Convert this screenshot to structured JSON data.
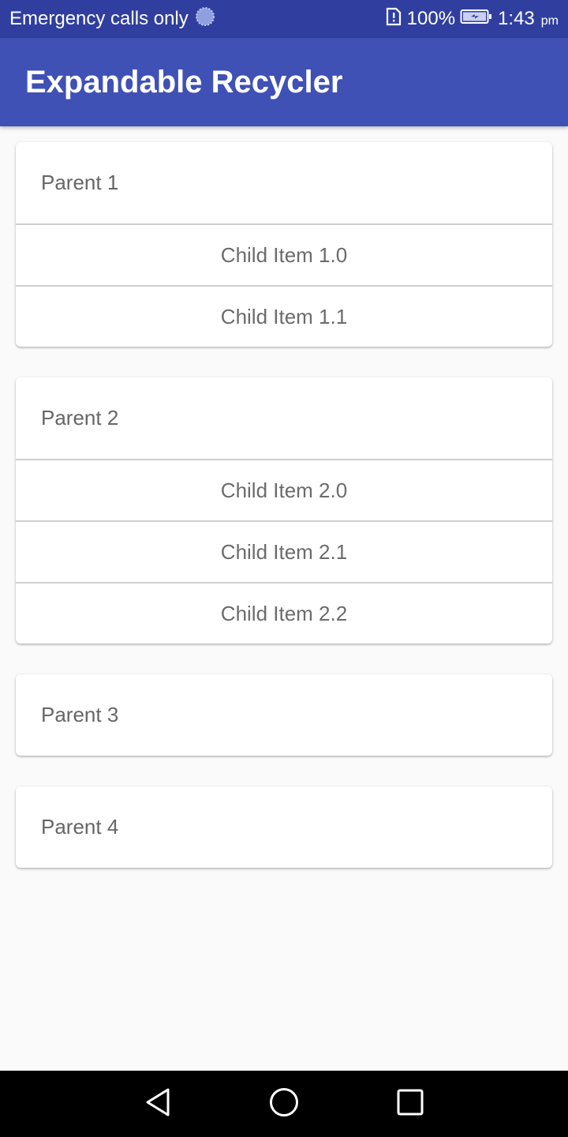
{
  "status_bar": {
    "carrier": "Emergency calls only",
    "battery": "100%",
    "time": "1:43",
    "ampm": "pm",
    "icons": [
      "sync-icon",
      "sim-alert-icon",
      "battery-charging-icon"
    ]
  },
  "app_bar": {
    "title": "Expandable Recycler"
  },
  "groups": [
    {
      "parent": "Parent 1",
      "children": [
        "Child Item 1.0",
        "Child Item 1.1"
      ]
    },
    {
      "parent": "Parent 2",
      "children": [
        "Child Item 2.0",
        "Child Item 2.1",
        "Child Item 2.2"
      ]
    },
    {
      "parent": "Parent 3",
      "children": []
    },
    {
      "parent": "Parent 4",
      "children": []
    }
  ],
  "nav_bar": {
    "icons": [
      "back-icon",
      "home-icon",
      "recents-icon"
    ]
  },
  "colors": {
    "status_bar": "#303f9f",
    "app_bar": "#3f51b5",
    "background": "#fafafa",
    "text": "#666666"
  }
}
